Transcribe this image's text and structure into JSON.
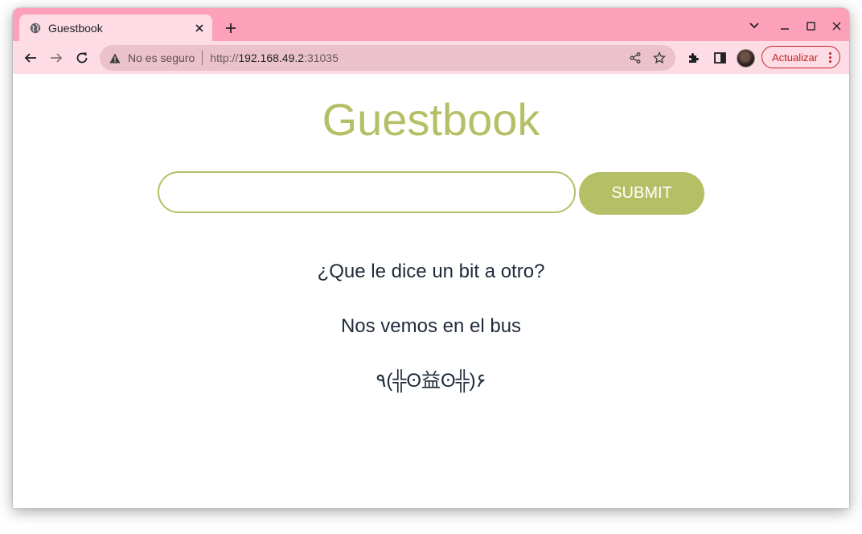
{
  "browser": {
    "tab_title": "Guestbook",
    "security_label": "No es seguro",
    "url_scheme": "http://",
    "url_host": "192.168.49.2",
    "url_port": ":31035",
    "update_label": "Actualizar"
  },
  "page": {
    "title": "Guestbook",
    "input_value": "",
    "submit_label": "SUBMIT",
    "entries": [
      "¿Que le dice un bit a otro?",
      "Nos vemos en el bus",
      "٩(╬ʘ益ʘ╬)۶"
    ]
  },
  "colors": {
    "accent": "#b5bf66",
    "tabstrip": "#fca1b9",
    "toolbar": "#fddce5",
    "update_red": "#c5221f"
  }
}
